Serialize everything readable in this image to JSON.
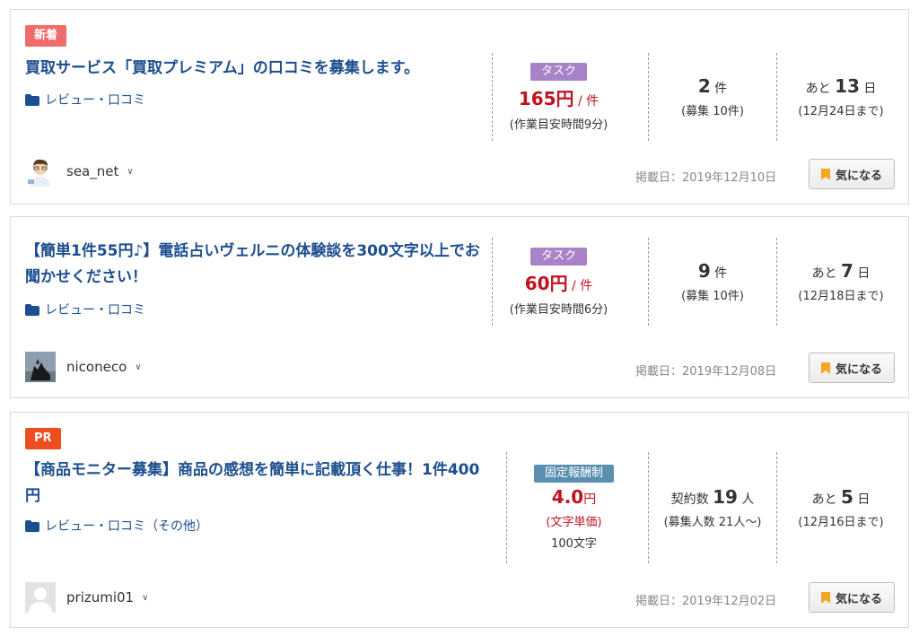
{
  "listings": [
    {
      "badge": "新着",
      "title": "買取サービス「買取プレミアム」の口コミを募集します。",
      "category": "レビュー・口コミ",
      "type": "タスク",
      "price": "165円",
      "price_unit": " / 件",
      "price_note": "(作業目安時間9分)",
      "count": "2",
      "count_unit": " 件",
      "count_note": "(募集 10件)",
      "days_prefix": "あと ",
      "days": "13",
      "days_suffix": " 日",
      "deadline": "(12月24日まで)",
      "user": "sea_net",
      "posted": "掲載日：2019年12月10日",
      "fav_label": "気になる"
    },
    {
      "title": "【簡単1件55円♪】電話占いヴェルニの体験談を300文字以上でお聞かせください！",
      "category": "レビュー・口コミ",
      "type": "タスク",
      "price": "60円",
      "price_unit": " / 件",
      "price_note": "(作業目安時間6分)",
      "count": "9",
      "count_unit": " 件",
      "count_note": "(募集 10件)",
      "days_prefix": "あと ",
      "days": "7",
      "days_suffix": " 日",
      "deadline": "(12月18日まで)",
      "user": "niconeco",
      "posted": "掲載日：2019年12月08日",
      "fav_label": "気になる"
    },
    {
      "badge": "PR",
      "title": "【商品モニター募集】商品の感想を簡単に記載頂く仕事！1件400円",
      "category": "レビュー・口コミ（その他）",
      "type": "固定報酬制",
      "price": "4.0",
      "price_unit": "円",
      "price_note": "(文字単価)",
      "price_note2": "100文字",
      "count_prefix": "契約数 ",
      "count": "19",
      "count_unit": " 人",
      "count_note": "(募集人数 21人〜)",
      "days_prefix": "あと ",
      "days": "5",
      "days_suffix": " 日",
      "deadline": "(12月16日まで)",
      "user": "prizumi01",
      "posted": "掲載日：2019年12月02日",
      "fav_label": "気になる"
    }
  ],
  "colors": {
    "title": "#1d4e8f",
    "price": "#c0131f",
    "task": "#a883c7",
    "fixed": "#5a8fb0",
    "new": "#f06b6b",
    "pr": "#ee4d1f",
    "bookmark": "#f5a623"
  },
  "icons": {
    "category": "folder-icon",
    "user_menu": "chevron-down-icon",
    "fav": "bookmark-icon"
  }
}
